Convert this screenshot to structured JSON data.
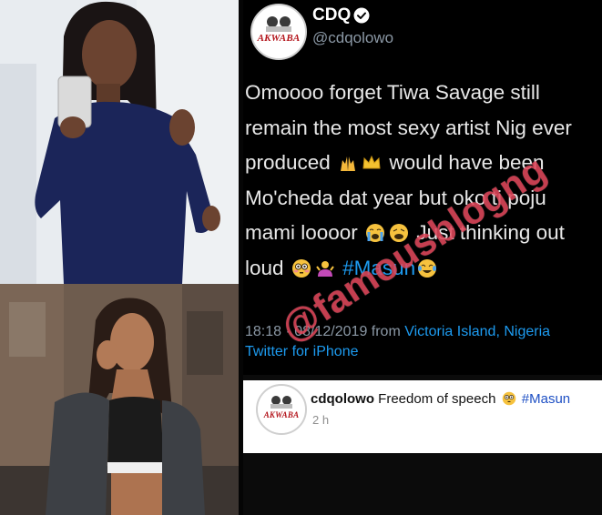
{
  "tweet": {
    "avatar_text": "AKWABA",
    "name": "CDQ",
    "handle": "@cdqolowo",
    "lines": [
      "Omoooo forget Tiwa Savage still",
      "remain the most sexy artist Nig ever",
      "produced",
      "would have been",
      "Mo'cheda dat year but oko ti poju",
      "mami loooor",
      "Just thinking out",
      "loud",
      "#Masun"
    ],
    "timestamp": "18:18 · 08/12/2019 from",
    "location": "Victoria Island, Nigeria",
    "source": "Twitter for iPhone"
  },
  "comment": {
    "avatar_text": "AKWABA",
    "username": "cdqolowo",
    "text": "Freedom of speech",
    "hashtag": "#Masun",
    "time": "2 h"
  },
  "watermark": "@famousblogng",
  "colors": {
    "tweet_bg": "#000000",
    "link_blue": "#1d9bf0",
    "watermark_red": "#de3c50",
    "comment_bg": "#ffffff"
  }
}
